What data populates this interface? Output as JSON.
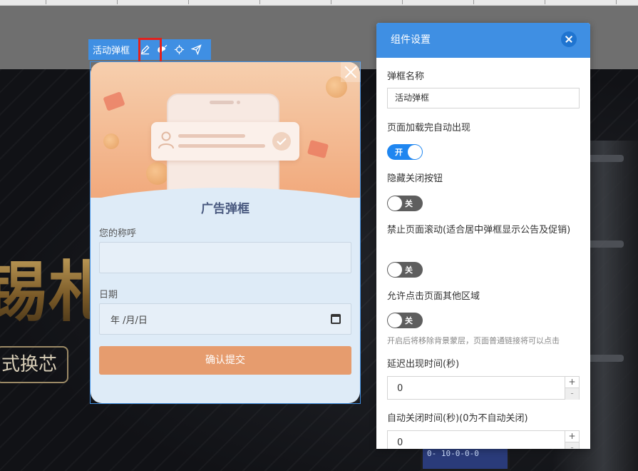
{
  "toolbar": {
    "label": "活动弹框",
    "buttons": [
      "edit-icon",
      "style-icon",
      "move-icon",
      "send-icon"
    ]
  },
  "background": {
    "hero_text": "锡札",
    "hero_tag": "式换芯",
    "meter_text": "0- 10-0-0-0"
  },
  "popup": {
    "title": "广告弹框",
    "name_label": "您的称呼",
    "name_value": "",
    "date_label": "日期",
    "date_placeholder": "年 /月/日",
    "submit_label": "确认提交"
  },
  "panel": {
    "title": "组件设置",
    "fields": {
      "popup_name_label": "弹框名称",
      "popup_name_value": "活动弹框",
      "auto_show_label": "页面加载完自动出现",
      "auto_show_state": "开",
      "hide_close_label": "隐藏关闭按钮",
      "hide_close_state": "关",
      "disable_scroll_label": "禁止页面滚动(适合居中弹框显示公告及促销)",
      "disable_scroll_state": "关",
      "allow_click_label": "允许点击页面其他区域",
      "allow_click_state": "关",
      "allow_click_hint": "开启后将移除背景蒙层，页面普通链接将可以点击",
      "delay_label": "延迟出现时间(秒)",
      "delay_value": "0",
      "auto_close_label": "自动关闭时间(秒)(0为不自动关闭)",
      "auto_close_value": "0"
    },
    "stepper_up": "+",
    "stepper_down": "-"
  },
  "colors": {
    "accent": "#3f8fe3",
    "toggle_on": "#1f86f0",
    "toggle_off": "#5e5e5e",
    "submit": "#e69c6e",
    "highlight": "#e3211c"
  }
}
